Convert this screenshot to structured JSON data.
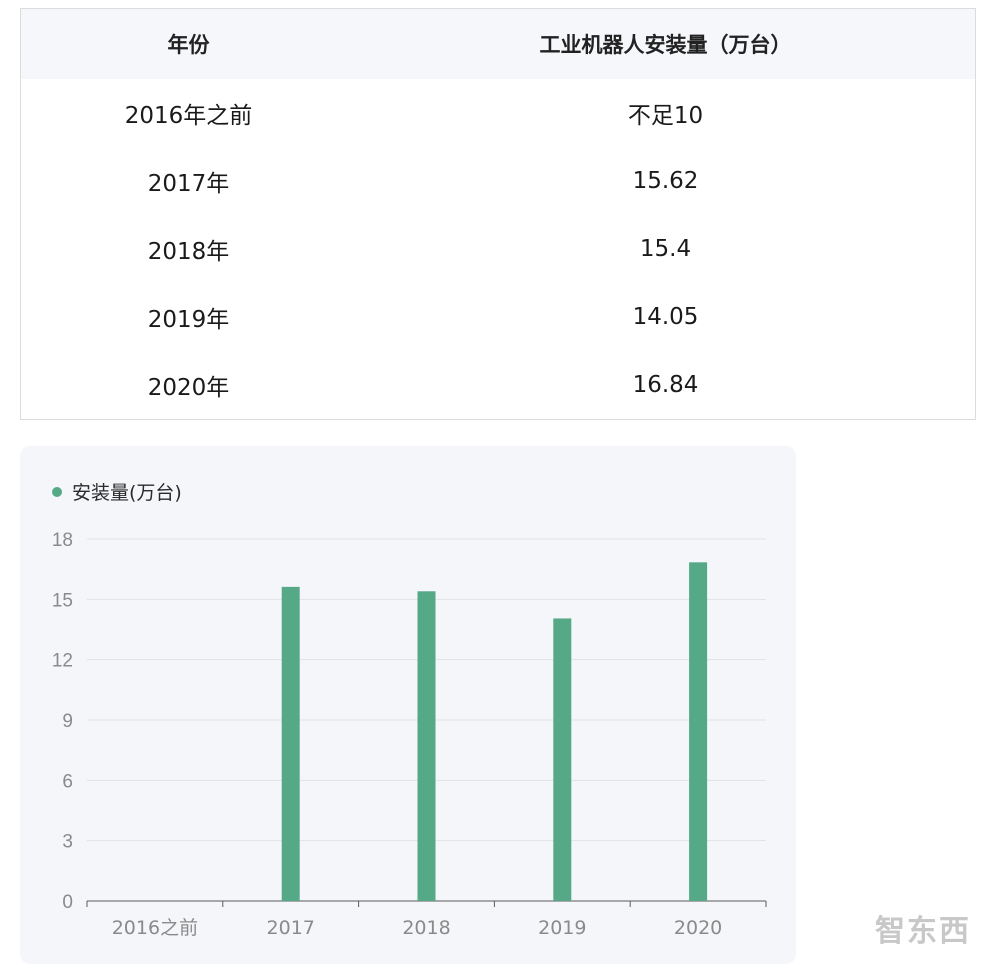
{
  "table": {
    "headers": [
      "年份",
      "工业机器人安装量（万台）"
    ],
    "rows": [
      [
        "2016年之前",
        "不足10"
      ],
      [
        "2017年",
        "15.62"
      ],
      [
        "2018年",
        "15.4"
      ],
      [
        "2019年",
        "14.05"
      ],
      [
        "2020年",
        "16.84"
      ]
    ]
  },
  "chart_data": {
    "type": "bar",
    "categories": [
      "2016之前",
      "2017",
      "2018",
      "2019",
      "2020"
    ],
    "series": [
      {
        "name": "安装量(万台)",
        "values": [
          null,
          15.62,
          15.4,
          14.05,
          16.84
        ],
        "color": "#55a987"
      }
    ],
    "ylim": [
      0,
      18
    ],
    "yticks": [
      0,
      3,
      6,
      9,
      12,
      15,
      18
    ],
    "grid": true,
    "legend": "top-left"
  },
  "watermark": "智东西"
}
